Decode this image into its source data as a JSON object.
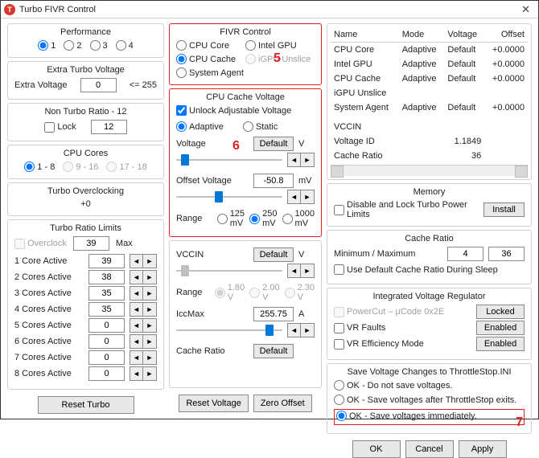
{
  "window": {
    "title": "Turbo FIVR Control",
    "icon_letter": "T"
  },
  "annotations": {
    "five": "5",
    "six": "6",
    "seven": "7"
  },
  "col1": {
    "performance": {
      "title": "Performance",
      "options": [
        "1",
        "2",
        "3",
        "4"
      ],
      "selected": 0
    },
    "extra_turbo": {
      "title": "Extra Turbo Voltage",
      "label": "Extra Voltage",
      "value": "0",
      "suffix": "<= 255"
    },
    "non_turbo": {
      "title": "Non Turbo Ratio - 12",
      "lock_label": "Lock",
      "lock_checked": false,
      "value": "12"
    },
    "cpu_cores": {
      "title": "CPU Cores",
      "options": [
        "1 - 8",
        "9 - 16",
        "17 - 18"
      ],
      "selected": 0
    },
    "overclock_title": "Turbo Overclocking",
    "overclock_value": "+0",
    "ratio_limits": {
      "title": "Turbo Ratio Limits",
      "overclock_label": "Overclock",
      "overclock_checked": false,
      "overclock_value": "39",
      "max_label": "Max",
      "rows": [
        {
          "label": "1 Core Active",
          "value": "39"
        },
        {
          "label": "2 Cores Active",
          "value": "38"
        },
        {
          "label": "3 Cores Active",
          "value": "35"
        },
        {
          "label": "4 Cores Active",
          "value": "35"
        },
        {
          "label": "5 Cores Active",
          "value": "0"
        },
        {
          "label": "6 Cores Active",
          "value": "0"
        },
        {
          "label": "7 Cores Active",
          "value": "0"
        },
        {
          "label": "8 Cores Active",
          "value": "0"
        }
      ]
    },
    "reset_btn": "Reset Turbo"
  },
  "col2": {
    "fivr": {
      "title": "FIVR Control",
      "items": [
        {
          "label": "CPU Core",
          "dim": false
        },
        {
          "label": "Intel GPU",
          "dim": false
        },
        {
          "label": "CPU Cache",
          "dim": false
        },
        {
          "label": "iGPU Unslice",
          "dim": true
        },
        {
          "label": "System Agent",
          "dim": false
        }
      ],
      "selected": 2
    },
    "cache_voltage": {
      "title": "CPU Cache Voltage",
      "unlock_label": "Unlock Adjustable Voltage",
      "unlock_checked": true,
      "mode_options": [
        "Adaptive",
        "Static"
      ],
      "mode_selected": 0,
      "voltage_label": "Voltage",
      "voltage_btn": "Default",
      "voltage_unit": "V",
      "offset_label": "Offset Voltage",
      "offset_value": "-50.8",
      "offset_unit": "mV",
      "range_label": "Range",
      "range_options": [
        "125 mV",
        "250 mV",
        "1000 mV"
      ],
      "range_selected": 1
    },
    "extra": {
      "vccin_label": "VCCIN",
      "vccin_btn": "Default",
      "vccin_unit": "V",
      "range_label": "Range",
      "range_options": [
        "1.80 V",
        "2.00 V",
        "2.30 V"
      ],
      "range_selected": 0,
      "iccmax_label": "IccMax",
      "iccmax_value": "255.75",
      "iccmax_unit": "A",
      "cache_ratio_label": "Cache Ratio",
      "cache_ratio_btn": "Default"
    },
    "buttons": {
      "reset": "Reset Voltage",
      "zero": "Zero Offset"
    }
  },
  "col3": {
    "table": {
      "headers": [
        "Name",
        "Mode",
        "Voltage",
        "Offset"
      ],
      "rows": [
        {
          "name": "CPU Core",
          "mode": "Adaptive",
          "voltage": "Default",
          "offset": "+0.0000"
        },
        {
          "name": "Intel GPU",
          "mode": "Adaptive",
          "voltage": "Default",
          "offset": "+0.0000"
        },
        {
          "name": "CPU Cache",
          "mode": "Adaptive",
          "voltage": "Default",
          "offset": "+0.0000"
        },
        {
          "name": "iGPU Unslice",
          "mode": "",
          "voltage": "",
          "offset": ""
        },
        {
          "name": "System Agent",
          "mode": "Adaptive",
          "voltage": "Default",
          "offset": "+0.0000"
        }
      ],
      "extra": [
        {
          "name": "VCCIN",
          "value": ""
        },
        {
          "name": "Voltage ID",
          "value": "1.1849"
        },
        {
          "name": "Cache Ratio",
          "value": "36"
        }
      ]
    },
    "memory": {
      "title": "Memory",
      "chk_label": "Disable and Lock Turbo Power Limits",
      "install_btn": "Install"
    },
    "cache_ratio": {
      "title": "Cache Ratio",
      "minmax_label": "Minimum / Maximum",
      "min": "4",
      "max": "36",
      "sleep_label": "Use Default Cache Ratio During Sleep"
    },
    "ivr": {
      "title": "Integrated Voltage Regulator",
      "powercut_label": "PowerCut  –  µCode 0x2E",
      "locked_btn": "Locked",
      "vr_faults_label": "VR Faults",
      "vr_eff_label": "VR Efficiency Mode",
      "enabled_btn": "Enabled"
    },
    "save": {
      "title": "Save Voltage Changes to ThrottleStop.INI",
      "options": [
        "OK - Do not save voltages.",
        "OK - Save voltages after ThrottleStop exits.",
        "OK - Save voltages immediately."
      ],
      "selected": 2
    },
    "buttons": {
      "ok": "OK",
      "cancel": "Cancel",
      "apply": "Apply"
    }
  }
}
